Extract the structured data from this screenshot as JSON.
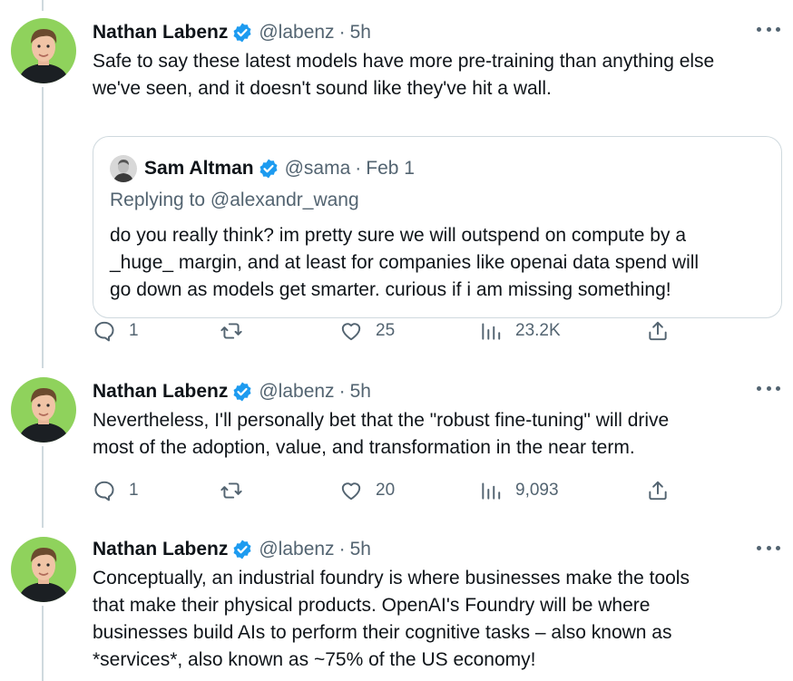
{
  "colors": {
    "accent": "#1d9bf0",
    "muted": "#536471",
    "text": "#0f1419",
    "border": "#cfd9de"
  },
  "tweets": [
    {
      "author_name": "Nathan Labenz",
      "handle": "@labenz",
      "time": "5h",
      "lines": [
        "Safe to say these latest models have more pre-training than anything else",
        "we've seen, and it doesn't sound like they've hit a wall."
      ],
      "quote": {
        "author_name": "Sam Altman",
        "handle": "@sama",
        "time": "Feb 1",
        "replying_prefix": "Replying to",
        "replying_to": "@alexandr_wang",
        "lines": [
          "do you really think? im pretty sure we will outspend on compute by a",
          "_huge_ margin, and at least for companies like openai data spend will",
          "go down as models get smarter. curious if i am missing something!"
        ]
      },
      "replies": "1",
      "retweets": "",
      "likes": "25",
      "views": "23.2K"
    },
    {
      "author_name": "Nathan Labenz",
      "handle": "@labenz",
      "time": "5h",
      "lines": [
        "Nevertheless, I'll personally bet that the \"robust fine-tuning\" will drive",
        "most of the adoption, value, and transformation in the near term."
      ],
      "replies": "1",
      "retweets": "",
      "likes": "20",
      "views": "9,093"
    },
    {
      "author_name": "Nathan Labenz",
      "handle": "@labenz",
      "time": "5h",
      "lines": [
        "Conceptually, an industrial foundry is where businesses make the tools",
        "that make their physical products. OpenAI's Foundry will be where",
        "businesses build AIs to perform their cognitive tasks – also known as",
        "*services*, also known as ~75% of the US economy!"
      ]
    }
  ],
  "icons": {
    "verified": "verified-badge-icon",
    "reply": "reply-icon",
    "retweet": "retweet-icon",
    "like": "heart-icon",
    "views": "views-chart-icon",
    "share": "share-icon",
    "more": "more-dots-icon"
  }
}
